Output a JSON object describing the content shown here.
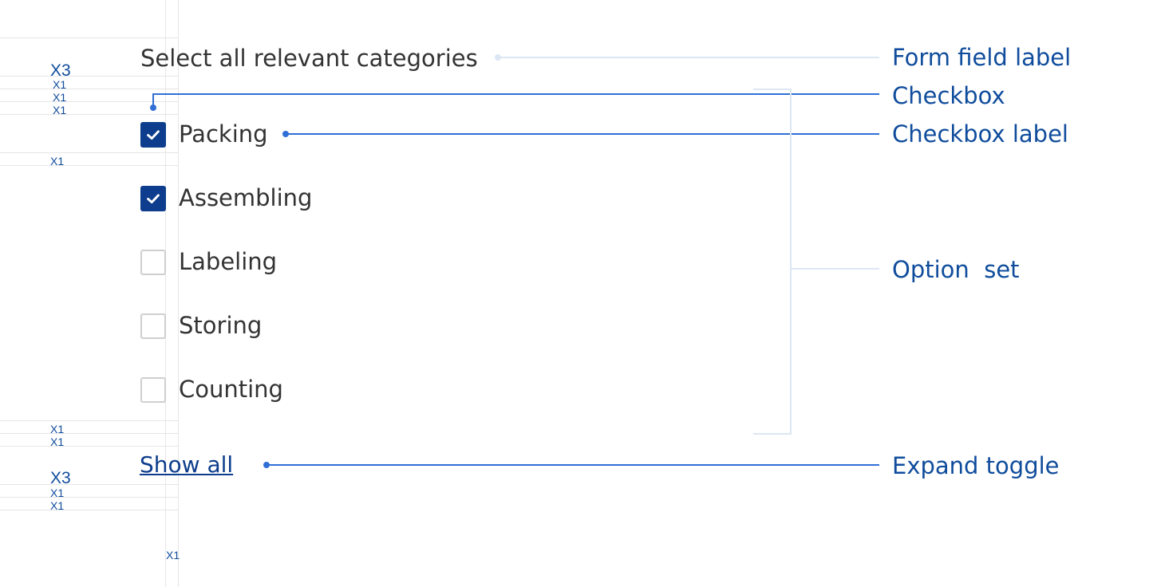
{
  "spacing_tags": {
    "top": [
      "X3",
      "X1",
      "X1",
      "X1",
      "X1"
    ],
    "bottom": [
      "X1",
      "X1",
      "X3",
      "X1",
      "X1"
    ],
    "below": "X1"
  },
  "form": {
    "legend": "Select all relevant categories",
    "options": [
      {
        "label": "Packing",
        "checked": true
      },
      {
        "label": "Assembling",
        "checked": true
      },
      {
        "label": "Labeling",
        "checked": false
      },
      {
        "label": "Storing",
        "checked": false
      },
      {
        "label": "Counting",
        "checked": false
      }
    ],
    "expand_toggle": "Show all"
  },
  "annotations": {
    "form_field_label": "Form field label",
    "checkbox": "Checkbox",
    "checkbox_label": "Checkbox label",
    "option_set": "Option  set",
    "expand_toggle": "Expand toggle"
  },
  "colors": {
    "checkbox_checked_fill": "#0d3d8c",
    "annotation_text": "#0f4c9c",
    "callout_line": "#2f6fd6",
    "grid_line": "#e6e6e6"
  }
}
